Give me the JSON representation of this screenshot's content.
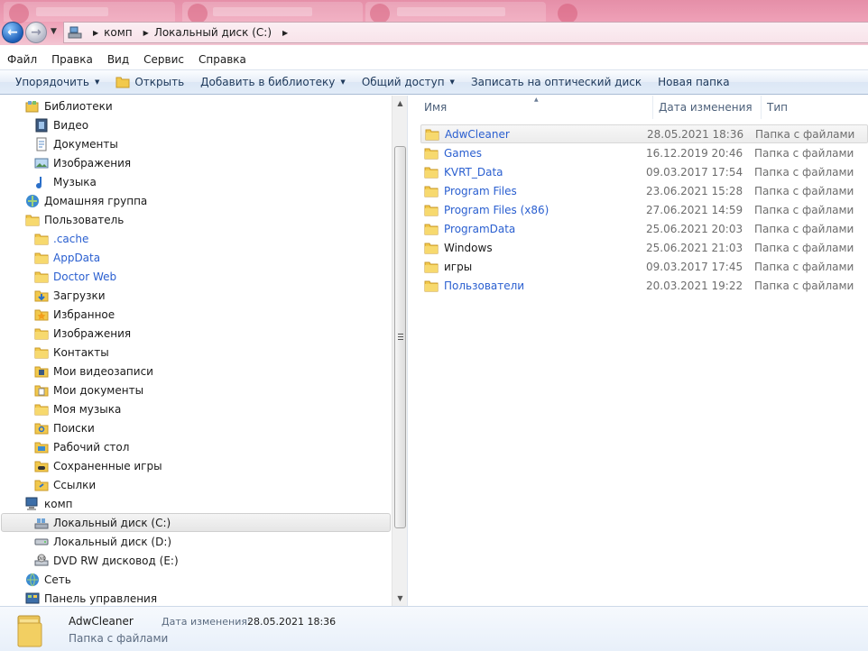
{
  "address": {
    "crumbs": [
      "комп",
      "Локальный диск (C:)"
    ]
  },
  "menu": [
    "Файл",
    "Правка",
    "Вид",
    "Сервис",
    "Справка"
  ],
  "commands": {
    "organize": "Упорядочить",
    "open": "Открыть",
    "add_to_library": "Добавить в библиотеку",
    "share": "Общий доступ",
    "burn": "Записать на оптический диск",
    "new_folder": "Новая папка"
  },
  "nav": {
    "items": [
      {
        "label": "Библиотеки",
        "icon": "libraries-icon",
        "level": 0
      },
      {
        "label": "Видео",
        "icon": "video-library-icon",
        "level": 1
      },
      {
        "label": "Документы",
        "icon": "documents-library-icon",
        "level": 1
      },
      {
        "label": "Изображения",
        "icon": "pictures-library-icon",
        "level": 1
      },
      {
        "label": "Музыка",
        "icon": "music-library-icon",
        "level": 1
      },
      {
        "label": "Домашняя группа",
        "icon": "homegroup-icon",
        "level": 0
      },
      {
        "label": "Пользователь",
        "icon": "user-folder-icon",
        "level": 0
      },
      {
        "label": ".cache",
        "icon": "folder-icon",
        "level": 1,
        "link": true
      },
      {
        "label": "AppData",
        "icon": "folder-icon",
        "level": 1,
        "link": true
      },
      {
        "label": "Doctor Web",
        "icon": "folder-icon",
        "level": 1,
        "link": true
      },
      {
        "label": "Загрузки",
        "icon": "downloads-icon",
        "level": 1
      },
      {
        "label": "Избранное",
        "icon": "favorites-icon",
        "level": 1
      },
      {
        "label": "Изображения",
        "icon": "pictures-folder-icon",
        "level": 1
      },
      {
        "label": "Контакты",
        "icon": "contacts-icon",
        "level": 1
      },
      {
        "label": "Мои видеозаписи",
        "icon": "videos-folder-icon",
        "level": 1
      },
      {
        "label": "Мои документы",
        "icon": "documents-folder-icon",
        "level": 1
      },
      {
        "label": "Моя музыка",
        "icon": "music-folder-icon",
        "level": 1
      },
      {
        "label": "Поиски",
        "icon": "searches-icon",
        "level": 1
      },
      {
        "label": "Рабочий стол",
        "icon": "desktop-folder-icon",
        "level": 1
      },
      {
        "label": "Сохраненные игры",
        "icon": "saved-games-icon",
        "level": 1
      },
      {
        "label": "Ссылки",
        "icon": "links-icon",
        "level": 1
      },
      {
        "label": "комп",
        "icon": "computer-icon",
        "level": 0
      },
      {
        "label": "Локальный диск (C:)",
        "icon": "local-disk-icon",
        "level": 1,
        "selected": true
      },
      {
        "label": "Локальный диск (D:)",
        "icon": "drive-icon",
        "level": 1
      },
      {
        "label": "DVD RW дисковод (E:)",
        "icon": "dvd-drive-icon",
        "level": 1
      },
      {
        "label": "Сеть",
        "icon": "network-icon",
        "level": 0
      },
      {
        "label": "Панель управления",
        "icon": "control-panel-icon",
        "level": 0
      }
    ]
  },
  "columns": {
    "name": "Имя",
    "date": "Дата изменения",
    "type": "Тип"
  },
  "files": [
    {
      "name": "AdwCleaner",
      "date": "28.05.2021 18:36",
      "type": "Папка с файлами",
      "link": true,
      "selected": true
    },
    {
      "name": "Games",
      "date": "16.12.2019 20:46",
      "type": "Папка с файлами",
      "link": true
    },
    {
      "name": "KVRT_Data",
      "date": "09.03.2017 17:54",
      "type": "Папка с файлами",
      "link": true
    },
    {
      "name": "Program Files",
      "date": "23.06.2021 15:28",
      "type": "Папка с файлами",
      "link": true
    },
    {
      "name": "Program Files (x86)",
      "date": "27.06.2021 14:59",
      "type": "Папка с файлами",
      "link": true
    },
    {
      "name": "ProgramData",
      "date": "25.06.2021 20:03",
      "type": "Папка с файлами",
      "link": true
    },
    {
      "name": "Windows",
      "date": "25.06.2021 21:03",
      "type": "Папка с файлами",
      "link": false
    },
    {
      "name": "игры",
      "date": "09.03.2017 17:45",
      "type": "Папка с файлами",
      "link": false
    },
    {
      "name": "Пользователи",
      "date": "20.03.2021 19:22",
      "type": "Папка с файлами",
      "link": true
    }
  ],
  "details": {
    "name": "AdwCleaner",
    "type": "Папка с файлами",
    "modified_label": "Дата изменения:",
    "modified_value": "28.05.2021 18:36"
  },
  "colors": {
    "title_pink": "#ee9fb6",
    "link_blue": "#2a5fd0",
    "folder_yellow": "#f2c94c"
  }
}
